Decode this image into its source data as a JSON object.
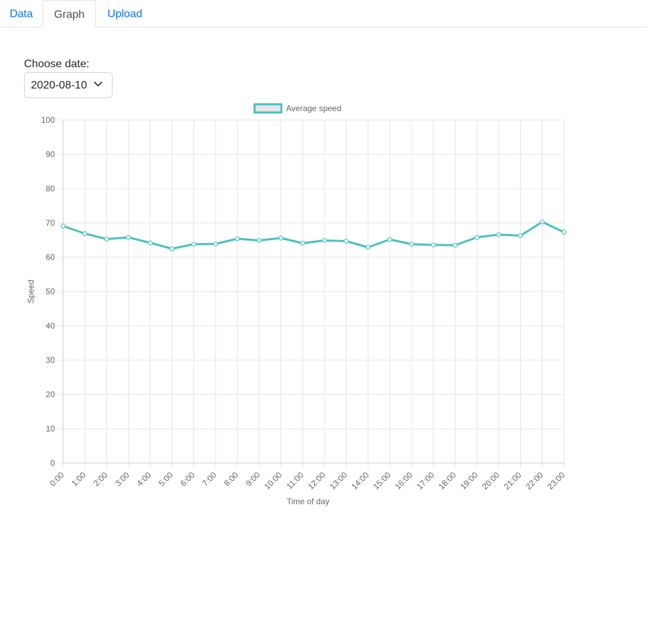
{
  "tabs": {
    "data_label": "Data",
    "graph_label": "Graph",
    "upload_label": "Upload"
  },
  "date_picker": {
    "label": "Choose date:",
    "selected": "2020-08-10"
  },
  "colors": {
    "accent": "#4bc0c0",
    "link": "#0d6efd",
    "grid": "#e5e5e5",
    "legend_fill": "#e6e6e6"
  },
  "chart_data": {
    "type": "line",
    "legend": "Average speed",
    "legend_position": "top",
    "xlabel": "Time of day",
    "ylabel": "Speed",
    "ylim": [
      0,
      100
    ],
    "yticks": [
      0,
      10,
      20,
      30,
      40,
      50,
      60,
      70,
      80,
      90,
      100
    ],
    "grid": true,
    "categories": [
      "0:00",
      "1:00",
      "2:00",
      "3:00",
      "4:00",
      "5:00",
      "6:00",
      "7:00",
      "8:00",
      "9:00",
      "10:00",
      "11:00",
      "12:00",
      "13:00",
      "14:00",
      "15:00",
      "16:00",
      "17:00",
      "18:00",
      "19:00",
      "20:00",
      "21:00",
      "22:00",
      "23:00"
    ],
    "series": [
      {
        "name": "Average speed",
        "values": [
          69.1,
          66.9,
          65.3,
          65.8,
          64.2,
          62.5,
          63.8,
          63.9,
          65.4,
          64.9,
          65.6,
          64.1,
          64.9,
          64.7,
          62.9,
          65.2,
          63.8,
          63.6,
          63.5,
          65.8,
          66.6,
          66.3,
          70.3,
          67.3
        ]
      }
    ]
  }
}
